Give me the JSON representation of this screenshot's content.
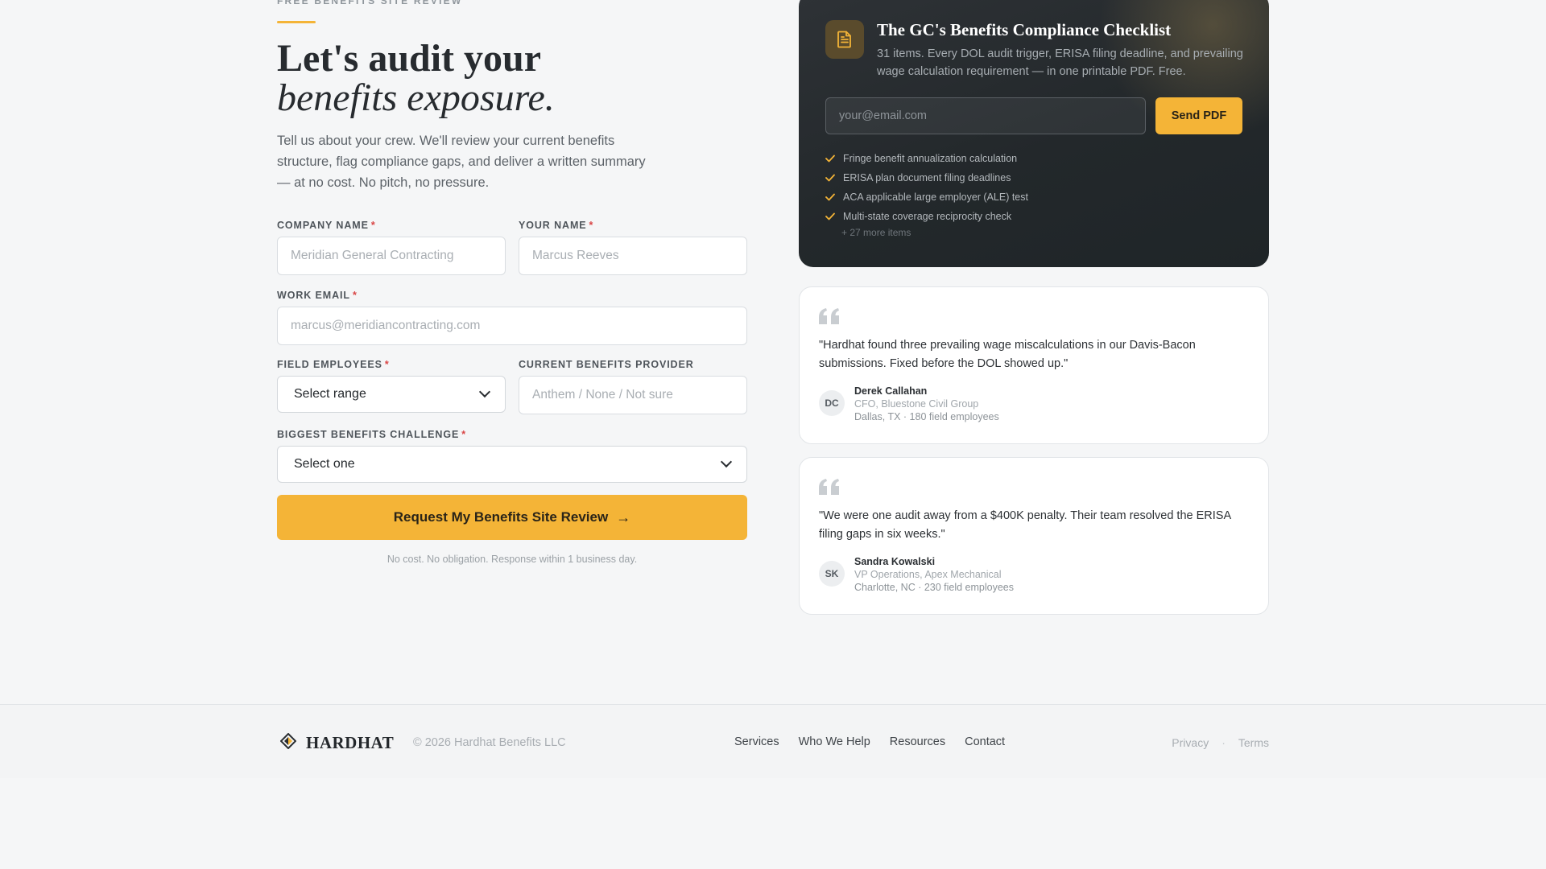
{
  "hero": {
    "eyebrow": "FREE BENEFITS SITE REVIEW",
    "headline_line1": "Let's audit your",
    "headline_line2": "benefits exposure.",
    "lede": "Tell us about your crew. We'll review your current benefits structure, flag compliance gaps, and deliver a written summary — at no cost. No pitch, no pressure."
  },
  "form": {
    "company": {
      "label": "COMPANY NAME",
      "required": "*",
      "placeholder": "Meridian General Contracting"
    },
    "name": {
      "label": "YOUR NAME",
      "required": "*",
      "placeholder": "Marcus Reeves"
    },
    "email": {
      "label": "WORK EMAIL",
      "required": "*",
      "placeholder": "marcus@meridiancontracting.com"
    },
    "employees": {
      "label": "FIELD EMPLOYEES",
      "required": "*",
      "selected": "Select range"
    },
    "provider": {
      "label": "CURRENT BENEFITS PROVIDER",
      "placeholder": "Anthem / None / Not sure"
    },
    "challenge": {
      "label": "BIGGEST BENEFITS CHALLENGE",
      "required": "*",
      "selected": "Select one"
    },
    "submit_label": "Request My Benefits Site Review",
    "submit_arrow": "→",
    "fineprint": "No cost. No obligation. Response within 1 business day."
  },
  "checklist": {
    "icon": "document-icon",
    "title": "The GC's Benefits Compliance Checklist",
    "description": "31 items. Every DOL audit trigger, ERISA filing deadline, and prevailing wage calculation requirement — in one printable PDF. Free.",
    "email_placeholder": "your@email.com",
    "send_label": "Send PDF",
    "items": [
      "Fringe benefit annualization calculation",
      "ERISA plan document filing deadlines",
      "ACA applicable large employer (ALE) test",
      "Multi-state coverage reciprocity check"
    ],
    "more": "+ 27 more items"
  },
  "testimonials": [
    {
      "quote": "\"Hardhat found three prevailing wage miscalculations in our Davis-Bacon submissions. Fixed before the DOL showed up.\"",
      "initials": "DC",
      "name": "Derek Callahan",
      "role": "CFO, Bluestone Civil Group",
      "meta": "Dallas, TX · 180 field employees"
    },
    {
      "quote": "\"We were one audit away from a $400K penalty. Their team resolved the ERISA filing gaps in six weeks.\"",
      "initials": "SK",
      "name": "Sandra Kowalski",
      "role": "VP Operations, Apex Mechanical",
      "meta": "Charlotte, NC · 230 field employees"
    }
  ],
  "footer": {
    "brand": "HARDHAT",
    "copyright": "© 2026 Hardhat Benefits LLC",
    "nav": [
      "Services",
      "Who We Help",
      "Resources",
      "Contact"
    ],
    "legal": [
      "Privacy",
      "Terms"
    ],
    "legal_separator": "·"
  },
  "colors": {
    "accent": "#f4b437",
    "dark_card": "#23282b",
    "required": "#d94545"
  }
}
